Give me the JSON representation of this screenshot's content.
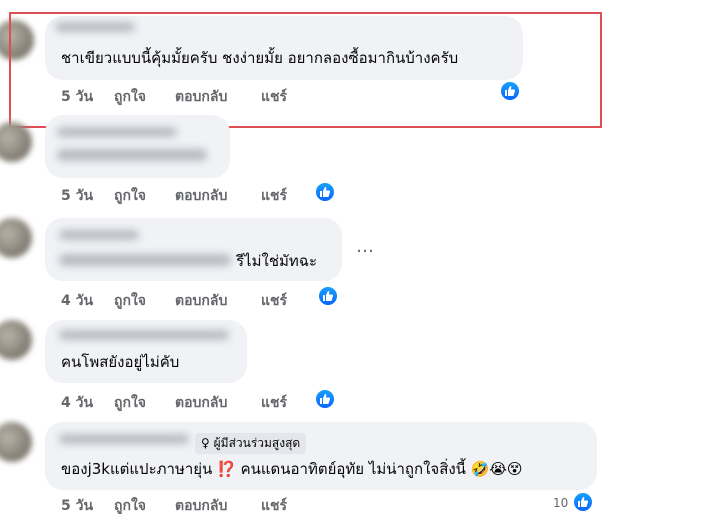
{
  "comments": [
    {
      "text": "ชาเขียวแบบนี้คุ้มมั้ยครับ ชงง่ายมั้ย อยากลองซื้อมากินบ้างครับ",
      "time": "5 วัน",
      "like": "ถูกใจ",
      "reply": "ตอบกลับ",
      "share": "แชร์"
    },
    {
      "text": "",
      "time": "5 วัน",
      "like": "ถูกใจ",
      "reply": "ตอบกลับ",
      "share": "แชร์"
    },
    {
      "text": "รีไม่ใช่มัทฉะ",
      "time": "4 วัน",
      "like": "ถูกใจ",
      "reply": "ตอบกลับ",
      "share": "แชร์"
    },
    {
      "text": "คนโพสยังอยู่ไม่คับ",
      "time": "4 วัน",
      "like": "ถูกใจ",
      "reply": "ตอบกลับ",
      "share": "แชร์"
    },
    {
      "badge": "ผู้มีส่วนร่วมสูงสุด",
      "text": "ของj3kแต่แปะภาษายุ่น",
      "text_after": "คนแดนอาทิตย์อุทัย ไม่น่าถูกใจสิ่งนี้",
      "time": "5 วัน",
      "like": "ถูกใจ",
      "reply": "ตอบกลับ",
      "share": "แชร์",
      "reaction_count": "10"
    }
  ],
  "more_options": "…",
  "icons": {
    "like": "like-thumb-icon",
    "badge": "top-fan-icon",
    "interrobang": "⁉️",
    "emojis": "🤣😭😵"
  },
  "colors": {
    "bubble": "#f0f2f5",
    "highlight": "#e04e55",
    "like_blue": "#0866ff",
    "meta_gray": "#65676b"
  }
}
